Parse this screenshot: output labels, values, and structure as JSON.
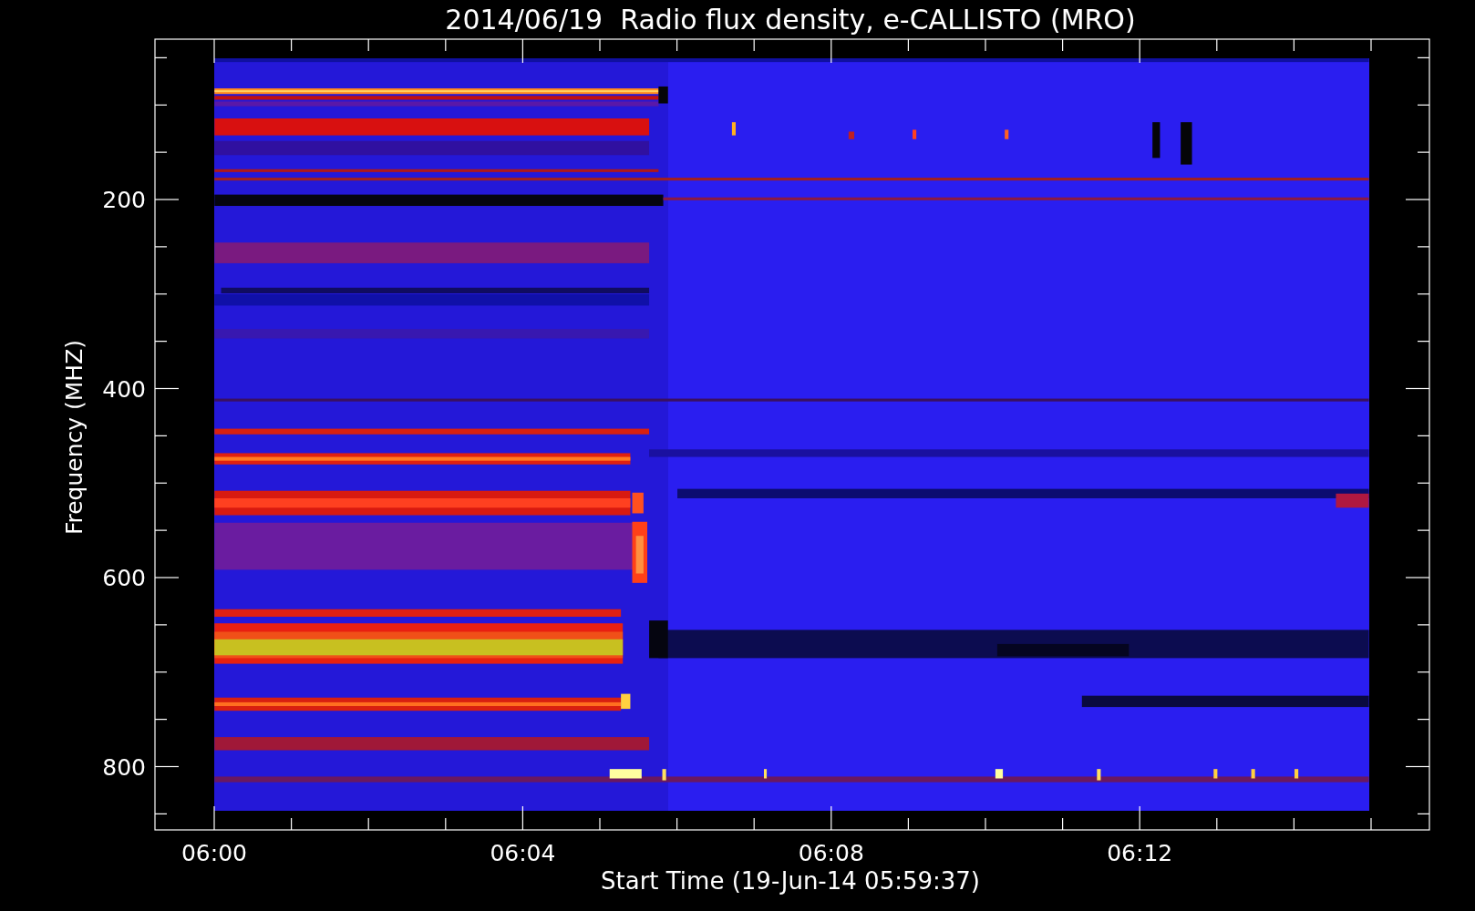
{
  "title": "2014/06/19  Radio flux density, e-CALLISTO (MRO)",
  "plot": {
    "ylabel": "Frequency (MHZ)",
    "xlabel": "Start Time (19-Jun-14 05:59:37)",
    "yticks": [
      "200",
      "400",
      "600",
      "800"
    ],
    "xticks": [
      "06:00",
      "06:04",
      "06:08",
      "06:12"
    ]
  }
}
